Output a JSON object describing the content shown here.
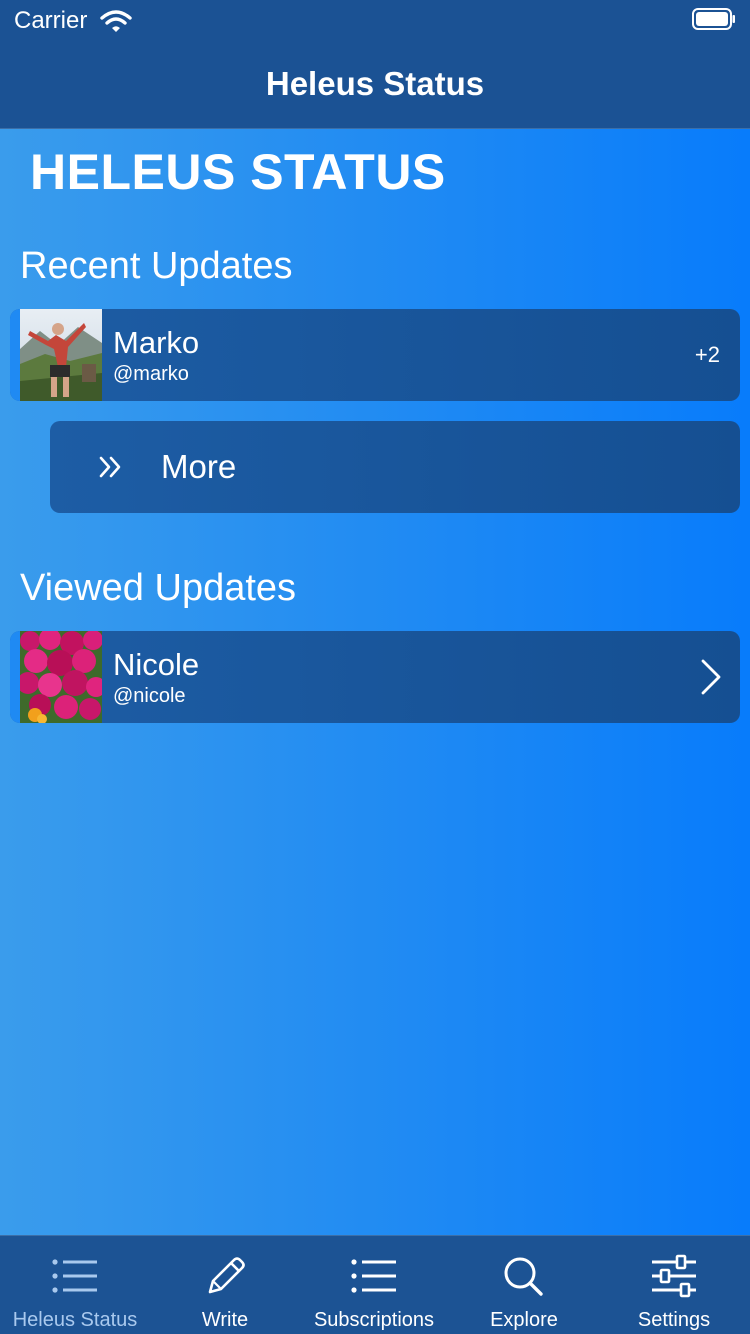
{
  "status_bar": {
    "carrier": "Carrier"
  },
  "nav": {
    "title": "Heleus Status"
  },
  "page": {
    "heading": "HELEUS STATUS"
  },
  "sections": {
    "recent": {
      "title": "Recent Updates",
      "rows": [
        {
          "name": "Marko",
          "handle": "@marko",
          "badge": "+2"
        }
      ],
      "more_label": "More"
    },
    "viewed": {
      "title": "Viewed Updates",
      "rows": [
        {
          "name": "Nicole",
          "handle": "@nicole"
        }
      ]
    }
  },
  "tabbar": {
    "tabs": [
      {
        "label": "Heleus Status",
        "icon": "list-icon",
        "selected": true
      },
      {
        "label": "Write",
        "icon": "pencil-icon",
        "selected": false
      },
      {
        "label": "Subscriptions",
        "icon": "list-icon",
        "selected": false
      },
      {
        "label": "Explore",
        "icon": "search-icon",
        "selected": false
      },
      {
        "label": "Settings",
        "icon": "sliders-icon",
        "selected": false
      }
    ]
  },
  "colors": {
    "nav_background": "#1b5294",
    "row_background": "#1d5da5",
    "gradient_start": "#3a9cec",
    "gradient_end": "#087cfb",
    "selected_tab": "#a9c9ee"
  }
}
